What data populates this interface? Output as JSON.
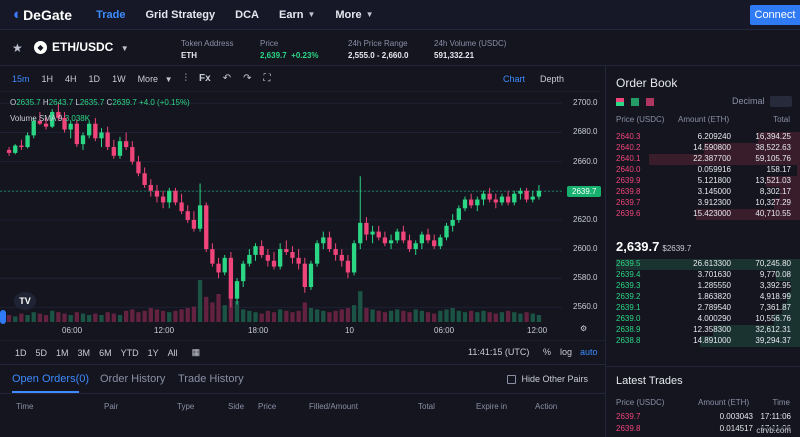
{
  "nav": {
    "logo": "DeGate",
    "items": [
      {
        "label": "Trade",
        "active": true,
        "dropdown": false
      },
      {
        "label": "Grid Strategy",
        "active": false,
        "dropdown": false
      },
      {
        "label": "DCA",
        "active": false,
        "dropdown": false
      },
      {
        "label": "Earn",
        "active": false,
        "dropdown": true
      },
      {
        "label": "More",
        "active": false,
        "dropdown": true
      }
    ],
    "connect_label": "Connect"
  },
  "pair": {
    "name": "ETH/USDC",
    "token_address_label": "Token Address",
    "token_address_value": "ETH",
    "price_label": "Price",
    "price_value": "2,639.7",
    "price_change": "+0.23%",
    "range_label": "24h Price Range",
    "range_value": "2,555.0 - 2,660.0",
    "volume_label": "24h Volume (USDC)",
    "volume_value": "591,332.21"
  },
  "chart_toolbar": {
    "timeframes": [
      "15m",
      "1H",
      "4H",
      "1D",
      "1W"
    ],
    "active_timeframe": "15m",
    "more_label": "More",
    "fx_label": "Fx",
    "view_chart": "Chart",
    "view_depth": "Depth"
  },
  "chart": {
    "ohlc": {
      "o": "2635.7",
      "h": "2643.7",
      "l": "2635.7",
      "c": "2639.7",
      "change": "+4.0 (+0.15%)"
    },
    "volume_label": "Volume",
    "sma_label": "SMA 9",
    "sma_value": "3.038K",
    "last_price_tag": "2639.7",
    "yticks": [
      "2700.0",
      "2680.0",
      "2660.0",
      "2639.7",
      "2620.0",
      "2600.0",
      "2580.0",
      "2560.0"
    ],
    "xticks": [
      "06:00",
      "12:00",
      "18:00",
      "10",
      "06:00",
      "12:00"
    ],
    "tv_logo": "TV"
  },
  "chart_data": {
    "type": "candlestick",
    "title": "",
    "ylim": [
      2550,
      2705
    ],
    "yticks": [
      2700,
      2680,
      2660,
      2640,
      2620,
      2600,
      2580,
      2560
    ],
    "xticks": [
      "06:00",
      "12:00",
      "18:00",
      "10",
      "06:00",
      "12:00"
    ],
    "last_price": 2639.7,
    "candles": [
      [
        2668,
        2670,
        2664,
        2666
      ],
      [
        2666,
        2672,
        2665,
        2671
      ],
      [
        2671,
        2675,
        2668,
        2670
      ],
      [
        2670,
        2680,
        2669,
        2678
      ],
      [
        2678,
        2690,
        2676,
        2688
      ],
      [
        2688,
        2694,
        2685,
        2686
      ],
      [
        2686,
        2690,
        2682,
        2684
      ],
      [
        2684,
        2696,
        2683,
        2694
      ],
      [
        2694,
        2700,
        2688,
        2690
      ],
      [
        2690,
        2694,
        2680,
        2682
      ],
      [
        2682,
        2688,
        2676,
        2686
      ],
      [
        2686,
        2689,
        2670,
        2672
      ],
      [
        2672,
        2680,
        2668,
        2678
      ],
      [
        2678,
        2688,
        2676,
        2686
      ],
      [
        2686,
        2690,
        2674,
        2676
      ],
      [
        2676,
        2683,
        2670,
        2680
      ],
      [
        2680,
        2684,
        2668,
        2670
      ],
      [
        2670,
        2675,
        2662,
        2664
      ],
      [
        2664,
        2677,
        2662,
        2674
      ],
      [
        2674,
        2680,
        2668,
        2670
      ],
      [
        2670,
        2674,
        2658,
        2660
      ],
      [
        2660,
        2664,
        2650,
        2652
      ],
      [
        2652,
        2656,
        2642,
        2644
      ],
      [
        2644,
        2648,
        2636,
        2640
      ],
      [
        2640,
        2644,
        2632,
        2636
      ],
      [
        2636,
        2640,
        2628,
        2632
      ],
      [
        2632,
        2642,
        2628,
        2640
      ],
      [
        2640,
        2642,
        2630,
        2632
      ],
      [
        2632,
        2638,
        2624,
        2626
      ],
      [
        2626,
        2630,
        2618,
        2620
      ],
      [
        2620,
        2626,
        2612,
        2614
      ],
      [
        2614,
        2645,
        2612,
        2630
      ],
      [
        2630,
        2632,
        2598,
        2600
      ],
      [
        2600,
        2604,
        2588,
        2590
      ],
      [
        2590,
        2594,
        2580,
        2584
      ],
      [
        2584,
        2596,
        2582,
        2594
      ],
      [
        2594,
        2598,
        2560,
        2566
      ],
      [
        2566,
        2580,
        2562,
        2578
      ],
      [
        2578,
        2592,
        2574,
        2590
      ],
      [
        2590,
        2600,
        2588,
        2596
      ],
      [
        2596,
        2604,
        2592,
        2602
      ],
      [
        2602,
        2606,
        2594,
        2596
      ],
      [
        2596,
        2600,
        2588,
        2592
      ],
      [
        2592,
        2598,
        2586,
        2588
      ],
      [
        2588,
        2604,
        2586,
        2600
      ],
      [
        2600,
        2606,
        2596,
        2598
      ],
      [
        2598,
        2602,
        2590,
        2594
      ],
      [
        2594,
        2600,
        2586,
        2590
      ],
      [
        2590,
        2594,
        2570,
        2574
      ],
      [
        2574,
        2592,
        2572,
        2590
      ],
      [
        2590,
        2606,
        2588,
        2604
      ],
      [
        2604,
        2612,
        2600,
        2608
      ],
      [
        2608,
        2612,
        2598,
        2600
      ],
      [
        2600,
        2604,
        2592,
        2596
      ],
      [
        2596,
        2600,
        2588,
        2592
      ],
      [
        2592,
        2596,
        2580,
        2584
      ],
      [
        2584,
        2606,
        2582,
        2604
      ],
      [
        2604,
        2650,
        2600,
        2618
      ],
      [
        2618,
        2622,
        2606,
        2610
      ],
      [
        2610,
        2616,
        2604,
        2612
      ],
      [
        2612,
        2616,
        2606,
        2608
      ],
      [
        2608,
        2612,
        2602,
        2604
      ],
      [
        2604,
        2610,
        2600,
        2606
      ],
      [
        2606,
        2614,
        2604,
        2612
      ],
      [
        2612,
        2616,
        2604,
        2606
      ],
      [
        2606,
        2610,
        2598,
        2600
      ],
      [
        2600,
        2606,
        2596,
        2604
      ],
      [
        2604,
        2612,
        2600,
        2610
      ],
      [
        2610,
        2614,
        2604,
        2606
      ],
      [
        2606,
        2610,
        2600,
        2602
      ],
      [
        2602,
        2610,
        2600,
        2608
      ],
      [
        2608,
        2618,
        2606,
        2616
      ],
      [
        2616,
        2624,
        2612,
        2620
      ],
      [
        2620,
        2630,
        2618,
        2628
      ],
      [
        2628,
        2636,
        2626,
        2634
      ],
      [
        2634,
        2638,
        2628,
        2630
      ],
      [
        2630,
        2636,
        2626,
        2634
      ],
      [
        2634,
        2640,
        2630,
        2638
      ],
      [
        2638,
        2642,
        2632,
        2634
      ],
      [
        2634,
        2638,
        2628,
        2632
      ],
      [
        2632,
        2638,
        2630,
        2636
      ],
      [
        2636,
        2640,
        2630,
        2632
      ],
      [
        2632,
        2640,
        2630,
        2638
      ],
      [
        2638,
        2642,
        2634,
        2640
      ],
      [
        2640,
        2642,
        2632,
        2634
      ],
      [
        2634,
        2640,
        2632,
        2636
      ],
      [
        2636,
        2644,
        2634,
        2640
      ]
    ],
    "volume": [
      5,
      4,
      6,
      5,
      7,
      6,
      5,
      8,
      7,
      6,
      5,
      7,
      6,
      5,
      6,
      5,
      7,
      6,
      5,
      8,
      9,
      7,
      8,
      10,
      9,
      8,
      7,
      8,
      9,
      10,
      11,
      30,
      18,
      14,
      20,
      12,
      26,
      15,
      9,
      8,
      7,
      6,
      8,
      7,
      9,
      8,
      7,
      8,
      14,
      10,
      9,
      8,
      7,
      8,
      9,
      10,
      12,
      22,
      10,
      9,
      8,
      7,
      8,
      9,
      8,
      7,
      9,
      8,
      7,
      6,
      8,
      9,
      10,
      8,
      7,
      8,
      7,
      8,
      7,
      6,
      7,
      8,
      7,
      6,
      7,
      6,
      5
    ]
  },
  "range_bar": {
    "ranges": [
      "1D",
      "5D",
      "1M",
      "3M",
      "6M",
      "YTD",
      "1Y",
      "All"
    ],
    "time": "11:41:15 (UTC)",
    "percent": "%",
    "log": "log",
    "auto": "auto"
  },
  "orders": {
    "tabs": [
      "Open Orders(0)",
      "Order History",
      "Trade History"
    ],
    "hide_other": "Hide Other Pairs",
    "columns": [
      "Time",
      "Pair",
      "Type",
      "Side",
      "Price",
      "Filled/Amount",
      "Total",
      "Expire in",
      "Action"
    ]
  },
  "orderbook": {
    "title": "Order Book",
    "decimal_label": "Decimal",
    "headers": [
      "Price (USDC)",
      "Amount (ETH)",
      "Total"
    ],
    "asks": [
      {
        "price": "2640.3",
        "amount": "6.209240",
        "total": "16,394.25",
        "depth": 0.22
      },
      {
        "price": "2640.2",
        "amount": "14.590800",
        "total": "38,522.63",
        "depth": 0.5
      },
      {
        "price": "2640.1",
        "amount": "22.387700",
        "total": "59,105.76",
        "depth": 0.78
      },
      {
        "price": "2640.0",
        "amount": "0.059916",
        "total": "158.17",
        "depth": 0.02
      },
      {
        "price": "2639.9",
        "amount": "5.121800",
        "total": "13,521.03",
        "depth": 0.18
      },
      {
        "price": "2639.8",
        "amount": "3.145000",
        "total": "8,302.17",
        "depth": 0.11
      },
      {
        "price": "2639.7",
        "amount": "3.912300",
        "total": "10,327.29",
        "depth": 0.14
      },
      {
        "price": "2639.6",
        "amount": "15.423000",
        "total": "40,710.55",
        "depth": 0.54
      }
    ],
    "mid_price": "2,639.7",
    "mid_sub": "$2639.7",
    "bids": [
      {
        "price": "2639.5",
        "amount": "26.613300",
        "total": "70,245.80",
        "depth": 0.95
      },
      {
        "price": "2639.4",
        "amount": "3.701630",
        "total": "9,770.08",
        "depth": 0.13
      },
      {
        "price": "2639.3",
        "amount": "1.285550",
        "total": "3,392.95",
        "depth": 0.05
      },
      {
        "price": "2639.2",
        "amount": "1.863820",
        "total": "4,918.99",
        "depth": 0.07
      },
      {
        "price": "2639.1",
        "amount": "2.789540",
        "total": "7,361.87",
        "depth": 0.1
      },
      {
        "price": "2639.0",
        "amount": "4.000290",
        "total": "10,556.76",
        "depth": 0.14
      },
      {
        "price": "2638.9",
        "amount": "12.358300",
        "total": "32,612.31",
        "depth": 0.45
      },
      {
        "price": "2638.8",
        "amount": "14.891000",
        "total": "39,294.37",
        "depth": 0.52
      }
    ]
  },
  "latest_trades": {
    "title": "Latest Trades",
    "headers": [
      "Price (USDC)",
      "Amount (ETH)",
      "Time"
    ],
    "rows": [
      {
        "price": "2639.7",
        "amount": "0.003043",
        "time": "17:11:06"
      },
      {
        "price": "2639.8",
        "amount": "0.014517",
        "time": "17:11:06"
      }
    ]
  },
  "watermark": "ctrvb.com",
  "colors": {
    "up": "#2bd685",
    "down": "#f0457a",
    "accent": "#3d8bff",
    "bg": "#14151f"
  }
}
